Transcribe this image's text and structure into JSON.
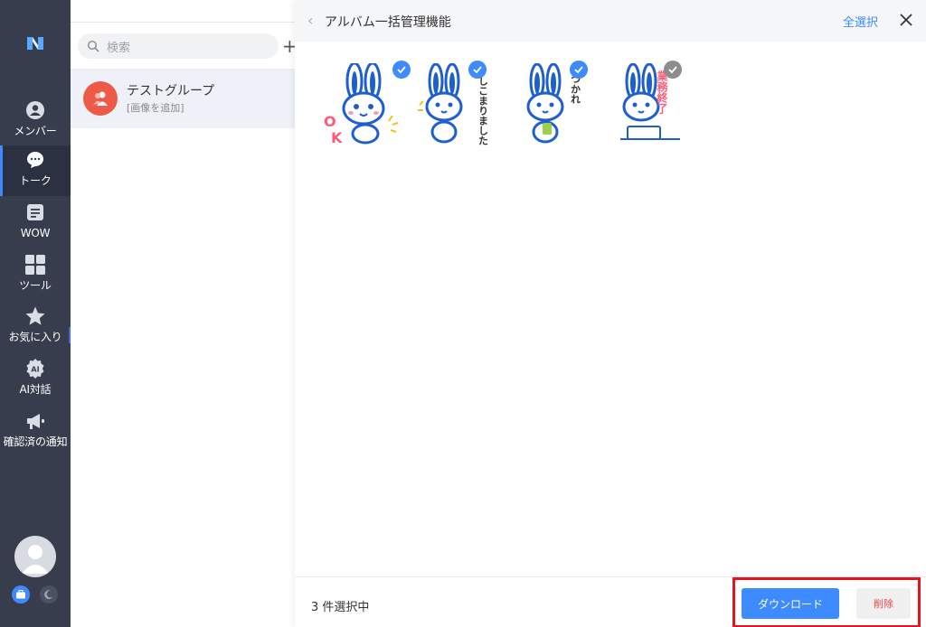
{
  "rail": {
    "items": [
      {
        "label": "メンバー",
        "icon": "person-icon"
      },
      {
        "label": "トーク",
        "icon": "chat-bubble-icon"
      },
      {
        "label": "WOW",
        "icon": "note-icon"
      },
      {
        "label": "ツール",
        "icon": "grid-icon"
      },
      {
        "label": "お気に入り",
        "icon": "star-icon"
      },
      {
        "label": "AI対話",
        "icon": "ai-icon"
      },
      {
        "label": "確認済の通知",
        "icon": "megaphone-icon"
      }
    ],
    "active_index": 1,
    "expander": "›"
  },
  "list": {
    "search_placeholder": "検索",
    "add_symbol": "+",
    "chat": {
      "name": "テストグループ",
      "subtitle": "[画像を追加]"
    }
  },
  "panel": {
    "back_symbol": "‹",
    "title": "アルバム一括管理機能",
    "select_all": "全選択",
    "images": [
      {
        "sticker": "OK",
        "checked": true
      },
      {
        "sticker": "しこまりました",
        "checked": true
      },
      {
        "sticker": "つかれさまです",
        "checked": true
      },
      {
        "sticker": "業務終了します",
        "checked": false
      }
    ],
    "footer": {
      "count_text": "3 件選択中",
      "download": "ダウンロード",
      "delete": "削除"
    }
  },
  "colors": {
    "accent": "#3d8bff",
    "rail_bg": "#373d4c",
    "highlight": "#e5151d",
    "delete_text": "#e8493f"
  }
}
